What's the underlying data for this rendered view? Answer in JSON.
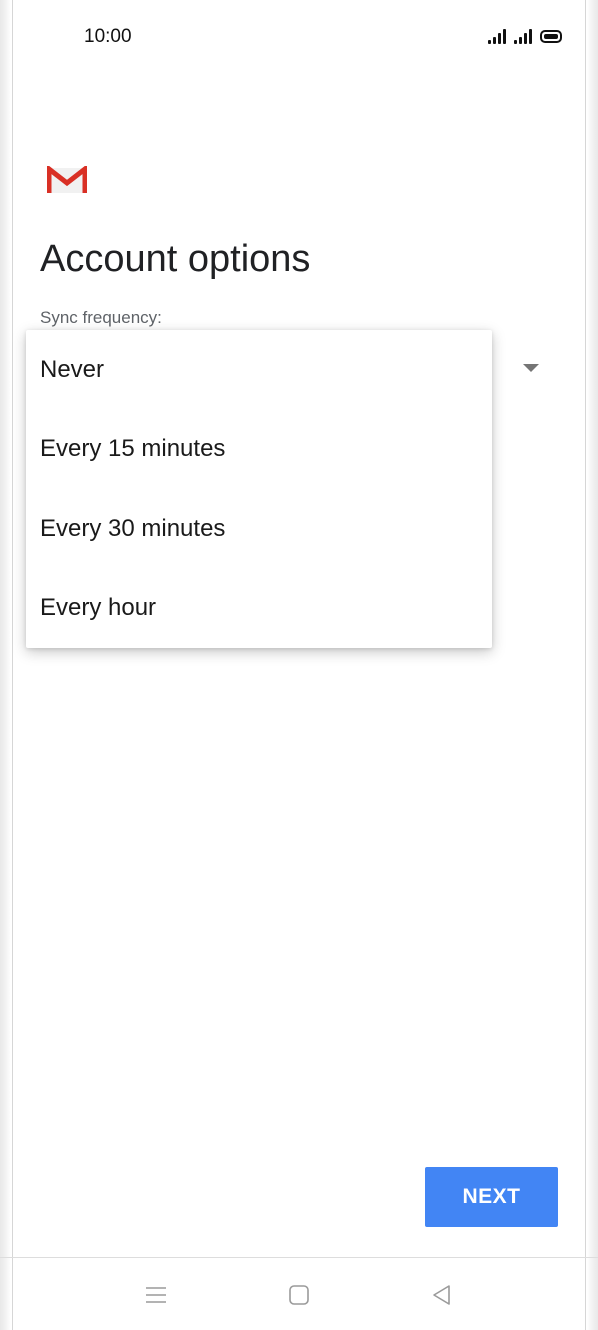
{
  "status_bar": {
    "time": "10:00",
    "icons": [
      "signal-icon",
      "signal-icon",
      "battery-icon"
    ]
  },
  "app": {
    "logo_icon": "gmail-logo-icon",
    "colors": {
      "gmail_red": "#d93025",
      "accent_blue": "#4285f4"
    }
  },
  "page": {
    "title": "Account options",
    "sync_label": "Sync frequency:"
  },
  "dropdown": {
    "options": [
      {
        "label": "Never"
      },
      {
        "label": "Every 15 minutes"
      },
      {
        "label": "Every 30 minutes"
      },
      {
        "label": "Every hour"
      }
    ]
  },
  "actions": {
    "next_label": "NEXT"
  },
  "nav_bar": {
    "icons": [
      "menu-icon",
      "home-icon",
      "back-icon"
    ]
  }
}
